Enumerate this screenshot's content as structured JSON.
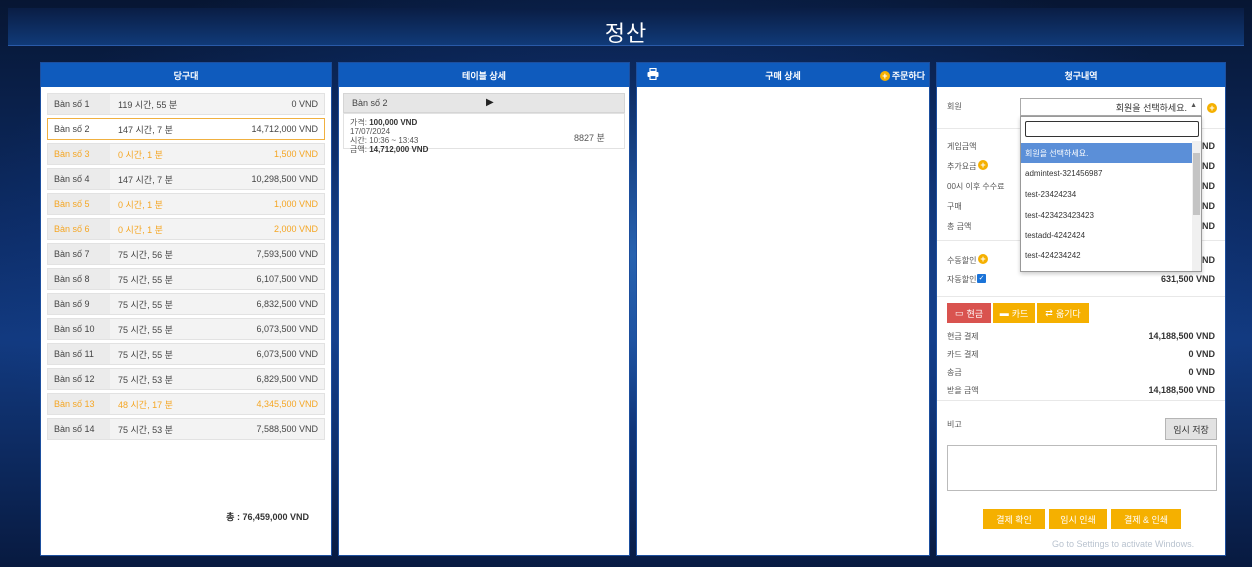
{
  "app": {
    "title": "정산"
  },
  "panel1": {
    "header": "당구대",
    "tables": [
      {
        "name": "Bàn số 1",
        "time": "119 시간, 55 분",
        "amount": "0 VND",
        "state": "normal"
      },
      {
        "name": "Bàn số 2",
        "time": "147 시간, 7 분",
        "amount": "14,712,000 VND",
        "state": "selected"
      },
      {
        "name": "Bàn số 3",
        "time": "0 시간, 1 분",
        "amount": "1,500 VND",
        "state": "orange"
      },
      {
        "name": "Bàn số 4",
        "time": "147 시간, 7 분",
        "amount": "10,298,500 VND",
        "state": "normal"
      },
      {
        "name": "Bàn số 5",
        "time": "0 시간, 1 분",
        "amount": "1,000 VND",
        "state": "orange"
      },
      {
        "name": "Bàn số 6",
        "time": "0 시간, 1 분",
        "amount": "2,000 VND",
        "state": "orange"
      },
      {
        "name": "Bàn số 7",
        "time": "75 시간, 56 분",
        "amount": "7,593,500 VND",
        "state": "normal"
      },
      {
        "name": "Bàn số 8",
        "time": "75 시간, 55 분",
        "amount": "6,107,500 VND",
        "state": "normal"
      },
      {
        "name": "Bàn số 9",
        "time": "75 시간, 55 분",
        "amount": "6,832,500 VND",
        "state": "normal"
      },
      {
        "name": "Bàn số 10",
        "time": "75 시간, 55 분",
        "amount": "6,073,500 VND",
        "state": "normal"
      },
      {
        "name": "Bàn số 11",
        "time": "75 시간, 55 분",
        "amount": "6,073,500 VND",
        "state": "normal"
      },
      {
        "name": "Bàn số 12",
        "time": "75 시간, 53 분",
        "amount": "6,829,500 VND",
        "state": "normal"
      },
      {
        "name": "Bàn số 13",
        "time": "48 시간, 17 분",
        "amount": "4,345,500 VND",
        "state": "orange"
      },
      {
        "name": "Bàn số 14",
        "time": "75 시간, 53 분",
        "amount": "7,588,500 VND",
        "state": "normal"
      }
    ],
    "total": "총 : 76,459,000 VND"
  },
  "panel2": {
    "header": "테이블 상세",
    "table_name": "Bàn số 2",
    "price_label": "가격:",
    "price": "100,000 VND",
    "date": "17/07/2024",
    "time_label": "시간:",
    "time": "10:36 ~ 13:43",
    "amount_label": "금액:",
    "amount": "14,712,000 VND",
    "minutes": "8827 분"
  },
  "panel3": {
    "header": "구매 상세",
    "order_label": "주문하다"
  },
  "panel4": {
    "header": "청구내역",
    "member_label": "회원",
    "member_select": "회원을 선택하세요.",
    "game_amount_label": "게임금액",
    "extra_label": "추가요금",
    "after_midnight_label": "00시 이후 수수료",
    "purchase_label": "구매",
    "total_label": "총 금액",
    "partial_values": [
      "ND",
      "ND",
      "ND",
      "ND",
      "ND"
    ],
    "manual_discount_label": "수동할인",
    "manual_discount_partial": "ND",
    "auto_discount_label": "자동할인",
    "auto_discount_value": "631,500 VND",
    "pay_cash": "현금",
    "pay_card": "카드",
    "pay_transfer": "옮기다",
    "cash_payment_label": "현금 결제",
    "cash_payment_value": "14,188,500 VND",
    "card_payment_label": "카드 결제",
    "card_payment_value": "0 VND",
    "transfer_label": "송금",
    "transfer_value": "0 VND",
    "receivable_label": "받을 금액",
    "receivable_value": "14,188,500 VND",
    "memo_label": "비고",
    "temp_save": "임시 저장",
    "confirm_payment": "결제 확인",
    "temp_print": "임시 인쇄",
    "pay_and_print": "결제 & 인쇄"
  },
  "dropdown": {
    "options": [
      "회원을 선택하세요.",
      "admintest-321456987",
      "test-23424234",
      "test-423423423423",
      "testadd-4242424",
      "test-424234242"
    ]
  },
  "watermark": "Go to Settings to activate Windows.",
  "colors": {
    "header_blue": "#0f5bbd",
    "accent_orange": "#f5a623",
    "cash_red": "#d9534f",
    "button_orange": "#f5b000"
  }
}
